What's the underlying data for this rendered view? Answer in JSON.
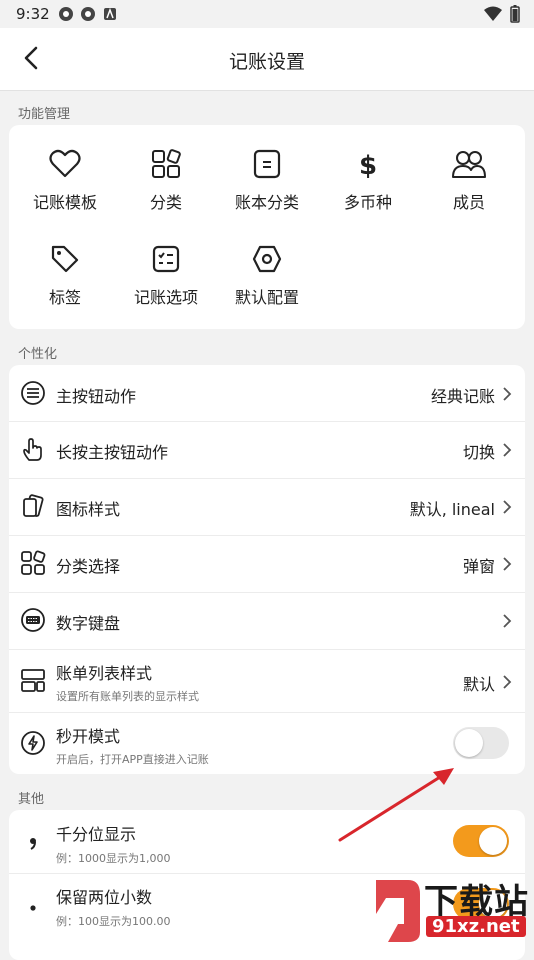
{
  "status": {
    "time": "9:32"
  },
  "header": {
    "title": "记账设置"
  },
  "sections": {
    "features": "功能管理",
    "personal": "个性化",
    "other": "其他"
  },
  "features": [
    {
      "label": "记账模板",
      "icon": "heart-icon"
    },
    {
      "label": "分类",
      "icon": "category-icon"
    },
    {
      "label": "账本分类",
      "icon": "book-icon"
    },
    {
      "label": "多币种",
      "icon": "dollar-icon"
    },
    {
      "label": "成员",
      "icon": "members-icon"
    },
    {
      "label": "标签",
      "icon": "tag-icon"
    },
    {
      "label": "记账选项",
      "icon": "options-icon"
    },
    {
      "label": "默认配置",
      "icon": "settings-hex-icon"
    }
  ],
  "personal": [
    {
      "label": "主按钮动作",
      "value": "经典记账",
      "icon": "menu-circle-icon"
    },
    {
      "label": "长按主按钮动作",
      "value": "切换",
      "icon": "hand-tap-icon"
    },
    {
      "label": "图标样式",
      "value": "默认, lineal",
      "icon": "icon-style-icon"
    },
    {
      "label": "分类选择",
      "value": "弹窗",
      "icon": "grid-icon"
    },
    {
      "label": "数字键盘",
      "value": "",
      "icon": "keyboard-icon"
    },
    {
      "label": "账单列表样式",
      "value": "默认",
      "subtitle": "设置所有账单列表的显示样式",
      "icon": "list-style-icon"
    },
    {
      "label": "秒开模式",
      "subtitle": "开启后，打开APP直接进入记账",
      "toggle": "off",
      "icon": "flash-icon"
    }
  ],
  "other": [
    {
      "label": "千分位显示",
      "subtitle": "例：1000显示为1,000",
      "toggle": "on",
      "icon": "comma-icon"
    },
    {
      "label": "保留两位小数",
      "subtitle": "例：100显示为100.00",
      "toggle": "on",
      "icon": "dot-icon"
    }
  ],
  "watermark": {
    "text": "下载站",
    "url": "91xz.net"
  },
  "colors": {
    "accent": "#f39a1c",
    "arrow": "#d8262c"
  }
}
